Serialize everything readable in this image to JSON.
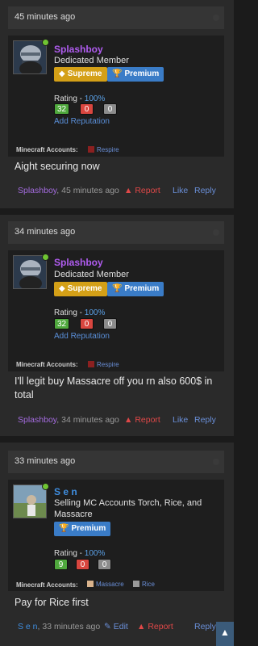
{
  "posts": [
    {
      "time": "45 minutes ago",
      "username": "Splashboy",
      "user_title": "Dedicated Member",
      "badges": [
        "Supreme",
        "Premium"
      ],
      "rating_label": "Rating - ",
      "rating_pct": "100%",
      "rep_pos": "32",
      "rep_neu": "0",
      "rep_neg": "0",
      "add_rep": "Add Reputation",
      "mc_label": "Minecraft Accounts:",
      "mc_accounts": [
        "Respire"
      ],
      "message": "Aight securing now",
      "footer_author": "Splashboy",
      "footer_time": ", 45 minutes ago",
      "report": "Report",
      "like": "Like",
      "reply": "Reply"
    },
    {
      "time": "34 minutes ago",
      "username": "Splashboy",
      "user_title": "Dedicated Member",
      "badges": [
        "Supreme",
        "Premium"
      ],
      "rating_label": "Rating - ",
      "rating_pct": "100%",
      "rep_pos": "32",
      "rep_neu": "0",
      "rep_neg": "0",
      "add_rep": "Add Reputation",
      "mc_label": "Minecraft Accounts:",
      "mc_accounts": [
        "Respire"
      ],
      "message": "I'll legit buy Massacre off you rn also 600$ in total",
      "footer_author": "Splashboy",
      "footer_time": ", 34 minutes ago",
      "report": "Report",
      "like": "Like",
      "reply": "Reply"
    },
    {
      "time": "33 minutes ago",
      "username": "S e n",
      "user_title": "Selling MC Accounts Torch, Rice, and Massacre",
      "badges": [
        "Premium"
      ],
      "rating_label": "Rating - ",
      "rating_pct": "100%",
      "rep_pos": "9",
      "rep_neu": "0",
      "rep_neg": "0",
      "mc_label": "Minecraft Accounts:",
      "mc_accounts": [
        "Massacre",
        "Rice"
      ],
      "message": "Pay for Rice first",
      "footer_author": "S e n",
      "footer_time": ", 33 minutes ago",
      "edit": "Edit",
      "report": "Report",
      "reply": "Reply"
    }
  ],
  "colors": {
    "supreme": "#d4a017",
    "premium": "#3a7cc7",
    "rep_pos": "#4fa83d",
    "rep_neu": "#d9463f",
    "rep_neg": "#8c8c8c",
    "splashboy_name": "#b05cf0",
    "sen_name": "#3f8ee0"
  },
  "icons": {
    "supreme": "diamond-icon",
    "premium": "trophy-icon",
    "report": "warning-icon",
    "edit": "pencil-icon",
    "scroll_top": "chevron-up-icon"
  }
}
